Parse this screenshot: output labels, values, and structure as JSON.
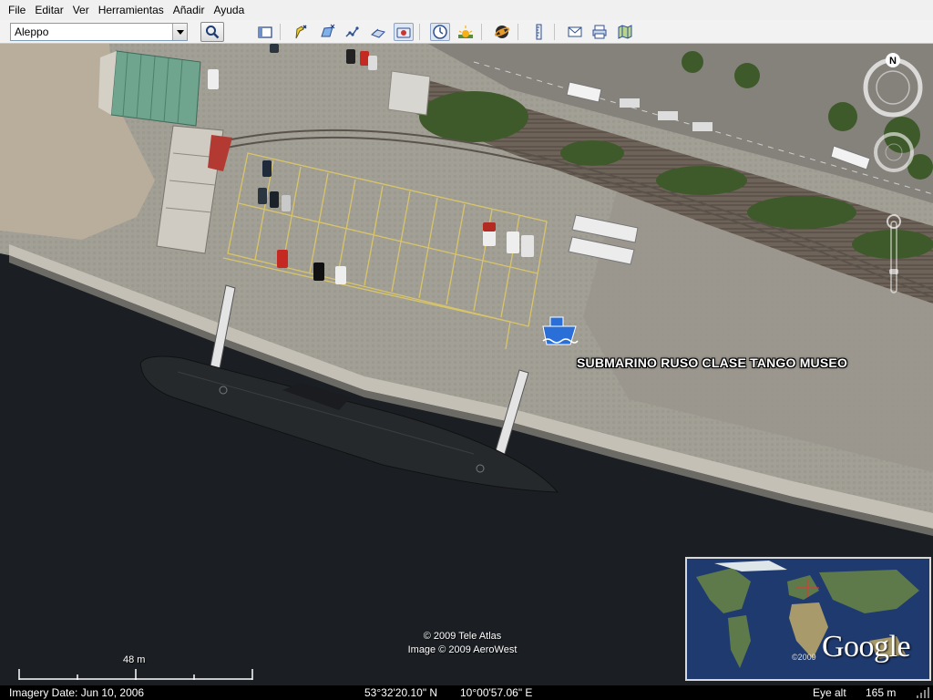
{
  "menu": [
    "File",
    "Editar",
    "Ver",
    "Herramientas",
    "Añadir",
    "Ayuda"
  ],
  "search": {
    "value": "Aleppo"
  },
  "toolbar": {
    "icons": [
      "sidebar-toggle-icon",
      "add-placemark-icon",
      "add-polygon-icon",
      "add-path-icon",
      "add-image-overlay-icon",
      "record-tour-icon",
      "historical-imagery-icon",
      "sunlight-icon",
      "switch-to-sky-icon",
      "ruler-icon",
      "email-icon",
      "print-icon",
      "maps-icon"
    ]
  },
  "map": {
    "placemark_label": "SUBMARINO RUSO CLASE TANGO MUSEO",
    "copyright_line1": "© 2009 Tele Atlas",
    "copyright_line2": "Image © 2009 AeroWest",
    "scale_label": "48 m",
    "compass_north": "N"
  },
  "overview": {
    "copyright": "©2009",
    "logo_text": "Google"
  },
  "status": {
    "imagery_date": "Imagery Date: Jun 10, 2006",
    "latitude": "53°32'20.10\" N",
    "longitude": "10°00'57.06\" E",
    "eye_alt_label": "Eye alt",
    "eye_alt_value": "165 m"
  },
  "colors": {
    "water": "#1b1f24",
    "quay": "#9a968d",
    "parking_lines": "#d8c56a",
    "grass": "#4f6b32",
    "placemark_icon": "#2a6fd8"
  }
}
